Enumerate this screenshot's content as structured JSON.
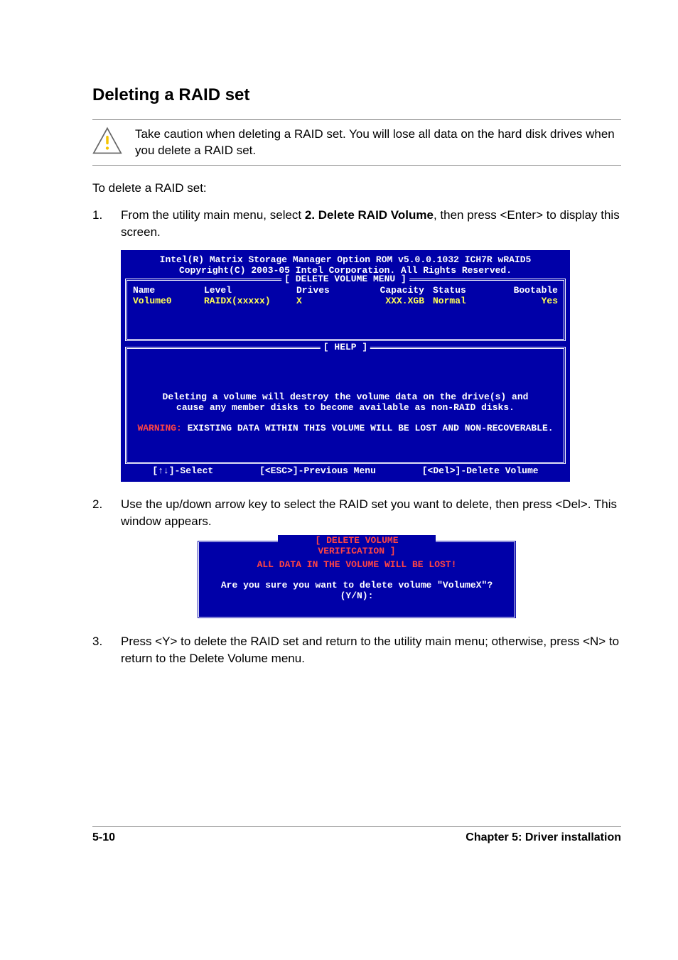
{
  "heading": "Deleting a RAID set",
  "caution": "Take caution when deleting a RAID set. You will lose all data on the hard disk drives when you delete a RAID set.",
  "intro": "To delete a RAID set:",
  "steps": [
    {
      "num": "1.",
      "pre": "From the utility main menu, select ",
      "bold": "2. Delete RAID Volume",
      "post": ", then press <Enter> to display this screen."
    },
    {
      "num": "2.",
      "text": "Use the up/down arrow key to select the RAID set you want to delete, then press <Del>. This window appears."
    },
    {
      "num": "3.",
      "text": "Press <Y> to delete the RAID set and return to the utility main menu; otherwise, press <N> to return to the Delete Volume menu."
    }
  ],
  "bios": {
    "title1": "Intel(R) Matrix Storage Manager Option ROM v5.0.0.1032 ICH7R wRAID5",
    "title2": "Copyright(C) 2003-05 Intel Corporation. All Rights Reserved.",
    "menu_label": "[ DELETE VOLUME MENU ]",
    "headers": {
      "name": "Name",
      "level": "Level",
      "drives": "Drives",
      "capacity": "Capacity",
      "status": "Status",
      "bootable": "Bootable"
    },
    "row": {
      "name": "Volume0",
      "level": "RAIDX(xxxxx)",
      "drives": "X",
      "capacity": "XXX.XGB",
      "status": "Normal",
      "bootable": "Yes"
    },
    "help_label": "[ HELP ]",
    "help_line1": "Deleting a volume will destroy the volume data on the drive(s) and",
    "help_line2": "cause any member disks to become available as non-RAID disks.",
    "warn_prefix": "WARNING:",
    "warn_text": " EXISTING DATA WITHIN THIS VOLUME WILL BE LOST AND NON-RECOVERABLE.",
    "footer": {
      "select": "[↑↓]-Select",
      "prev": "[<ESC>]-Previous Menu",
      "del": "[<Del>]-Delete Volume"
    }
  },
  "dialog": {
    "label": "[ DELETE VOLUME VERIFICATION ]",
    "line1": "ALL DATA IN THE VOLUME WILL BE LOST!",
    "line2": "Are you sure you want to delete volume \"VolumeX\"? (Y/N):"
  },
  "footer": {
    "left": "5-10",
    "right": "Chapter 5: Driver installation"
  }
}
